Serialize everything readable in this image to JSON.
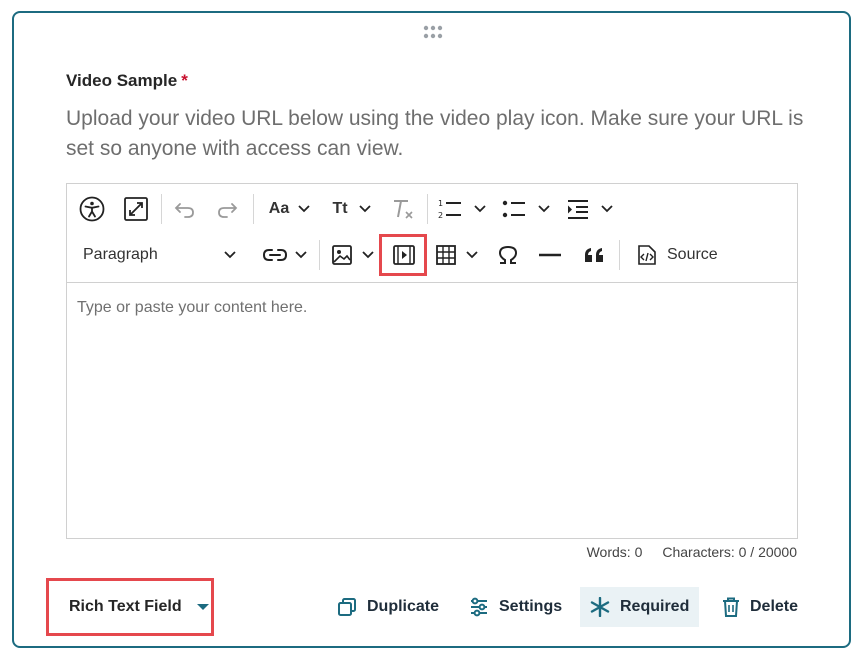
{
  "field": {
    "title": "Video Sample",
    "required_mark": "*",
    "instructions": "Upload your video URL below using the video play icon. Make sure your URL is set so anyone with access can view."
  },
  "toolbar": {
    "font_size_label": "Aa",
    "text_transform_label": "Tt",
    "paragraph_label": "Paragraph",
    "source_label": "Source"
  },
  "editor": {
    "placeholder": "Type or paste your content here.",
    "words_count": "Words: 0",
    "characters_count": "Characters: 0 / 20000"
  },
  "footer": {
    "field_type": "Rich Text Field",
    "duplicate_label": "Duplicate",
    "settings_label": "Settings",
    "required_label": "Required",
    "delete_label": "Delete"
  },
  "colors": {
    "accent": "#1c6b80",
    "highlight": "#e5484d",
    "required": "#c8102e"
  }
}
